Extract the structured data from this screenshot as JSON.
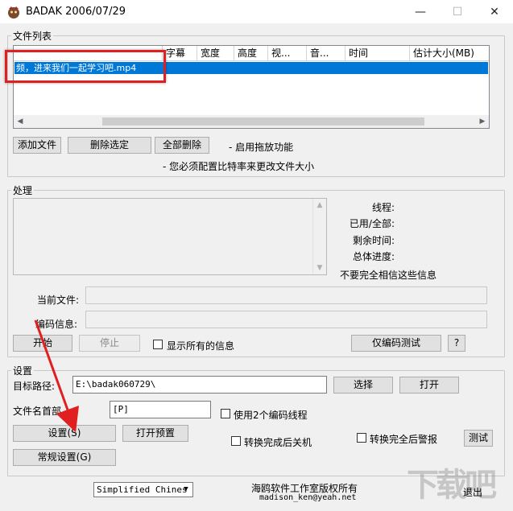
{
  "window": {
    "title": "BADAK 2006/07/29",
    "minimize": "—",
    "maximize": "☐",
    "close": "✕"
  },
  "file_list": {
    "legend": "文件列表",
    "columns": [
      "",
      "字幕",
      "宽度",
      "高度",
      "视...",
      "音...",
      "时间",
      "估计大小(MB)"
    ],
    "rows": [
      "频，进来我们一起学习吧.mp4"
    ],
    "add_button": "添加文件",
    "delete_selected_button": "删除选定",
    "delete_all_button": "全部删除",
    "drag_note": "- 启用拖放功能",
    "bitrate_note": "- 您必须配置比特率来更改文件大小"
  },
  "processing": {
    "legend": "处理",
    "threads_label": "线程:",
    "used_total_label": "已用/全部:",
    "remaining_label": "剩余时间:",
    "progress_label": "总体进度:",
    "disclaimer": "不要完全相信这些信息",
    "current_file_label": "当前文件:",
    "encode_info_label": "编码信息:",
    "start_button": "开始",
    "stop_button": "停止",
    "show_all_info_label": "显示所有的信息",
    "encode_test_button": "仅编码测试",
    "help_button": "?"
  },
  "settings": {
    "legend": "设置",
    "target_path_label": "目标路径:",
    "target_path_value": "E:\\badak060729\\",
    "choose_button": "选择",
    "open_button": "打开",
    "filename_prefix_label": "文件名首部",
    "filename_prefix_value": "[P]",
    "use_two_threads_label": "使用2个编码线程",
    "settings_button": "设置(S)",
    "open_preset_button": "打开预置",
    "shutdown_label": "转换完成后关机",
    "alarm_label": "转换完全后警报",
    "test_button": "测试",
    "general_settings_button": "常规设置(G)"
  },
  "footer": {
    "language_value": "Simplified Chines",
    "copyright": "海鸥软件工作室版权所有",
    "email": "madison_ken@yeah.net",
    "exit_button": "退出",
    "watermark": "下载吧"
  },
  "colors": {
    "selection": "#0078d7",
    "highlight_box": "#e02020",
    "annotation_arrow": "#e02020"
  }
}
